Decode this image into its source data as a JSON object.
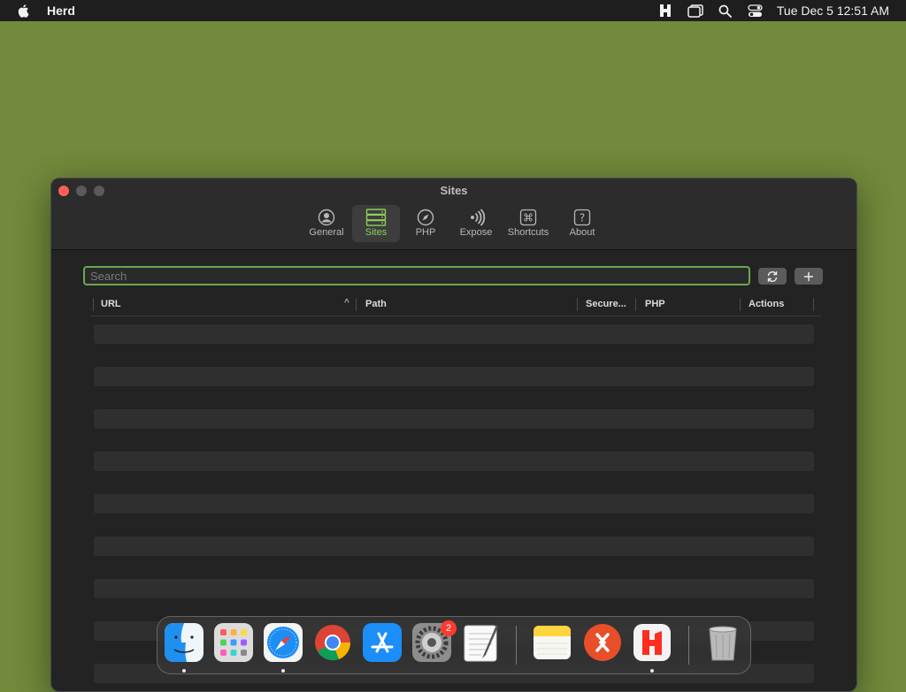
{
  "menubar": {
    "app_name": "Herd",
    "clock": "Tue Dec 5  12:51 AM",
    "icons": [
      "herd-icon",
      "window-icon",
      "search-icon",
      "control-center-icon"
    ]
  },
  "window": {
    "title": "Sites",
    "tabs": [
      {
        "label": "General",
        "icon": "person-circle-icon"
      },
      {
        "label": "Sites",
        "icon": "server-stack-icon",
        "active": true
      },
      {
        "label": "PHP",
        "icon": "compass-icon"
      },
      {
        "label": "Expose",
        "icon": "broadcast-icon"
      },
      {
        "label": "Shortcuts",
        "icon": "command-key-icon"
      },
      {
        "label": "About",
        "icon": "question-icon"
      }
    ]
  },
  "search": {
    "placeholder": "Search",
    "value": ""
  },
  "table": {
    "columns": [
      "URL",
      "Path",
      "Secure...",
      "PHP",
      "Actions"
    ],
    "sort_column": "URL",
    "rows": []
  },
  "dock": {
    "apps": [
      "Finder",
      "Launchpad",
      "Safari",
      "Chrome",
      "App Store",
      "System Settings",
      "TextEdit",
      "Notes",
      "Remote Desktop",
      "Herd",
      "Trash"
    ],
    "system_settings_badge": "2"
  },
  "colors": {
    "desktop": "#728a3b",
    "accent": "#8fcf5a",
    "focus_ring": "#6aa84f"
  }
}
